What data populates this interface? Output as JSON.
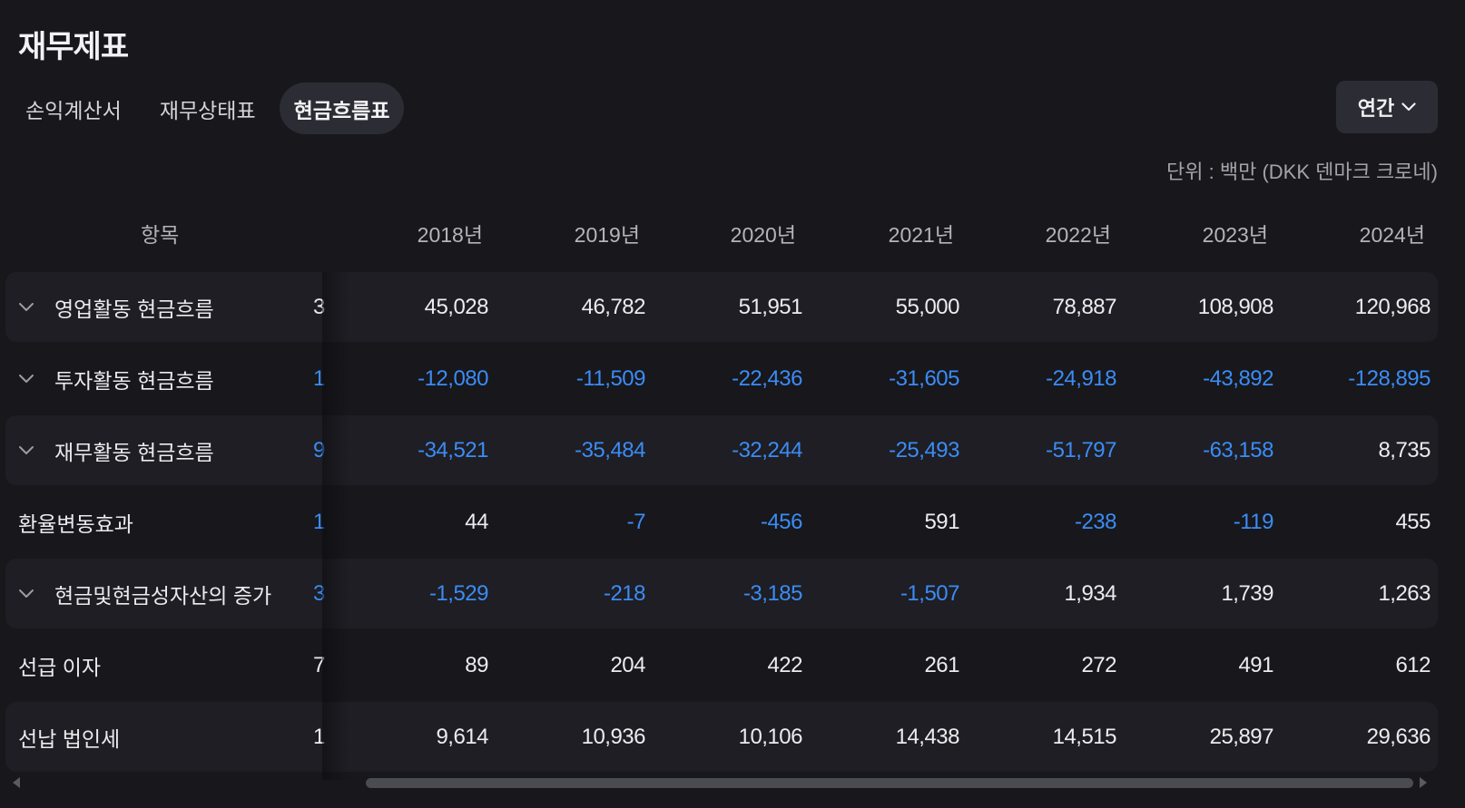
{
  "title": "재무제표",
  "tabs": [
    {
      "label": "손익계산서",
      "active": false
    },
    {
      "label": "재무상태표",
      "active": false
    },
    {
      "label": "현금흐름표",
      "active": true
    }
  ],
  "period": {
    "label": "연간",
    "icon": "chevron-down-icon"
  },
  "unit": "단위 : 백만 (DKK 덴마크 크로네)",
  "table": {
    "item_header": "항목",
    "years": [
      "2018년",
      "2019년",
      "2020년",
      "2021년",
      "2022년",
      "2023년",
      "2024년"
    ],
    "rows": [
      {
        "label": "영업활동 현금흐름",
        "expandable": true,
        "cut": "3",
        "cut_neg": false,
        "values": [
          "45,028",
          "46,782",
          "51,951",
          "55,000",
          "78,887",
          "108,908",
          "120,968"
        ],
        "neg": [
          false,
          false,
          false,
          false,
          false,
          false,
          false
        ]
      },
      {
        "label": "투자활동 현금흐름",
        "expandable": true,
        "cut": "1",
        "cut_neg": true,
        "values": [
          "-12,080",
          "-11,509",
          "-22,436",
          "-31,605",
          "-24,918",
          "-43,892",
          "-128,895"
        ],
        "neg": [
          true,
          true,
          true,
          true,
          true,
          true,
          true
        ]
      },
      {
        "label": "재무활동 현금흐름",
        "expandable": true,
        "cut": "9",
        "cut_neg": true,
        "values": [
          "-34,521",
          "-35,484",
          "-32,244",
          "-25,493",
          "-51,797",
          "-63,158",
          "8,735"
        ],
        "neg": [
          true,
          true,
          true,
          true,
          true,
          true,
          false
        ]
      },
      {
        "label": "환율변동효과",
        "expandable": false,
        "cut": "1",
        "cut_neg": true,
        "values": [
          "44",
          "-7",
          "-456",
          "591",
          "-238",
          "-119",
          "455"
        ],
        "neg": [
          false,
          true,
          true,
          false,
          true,
          true,
          false
        ]
      },
      {
        "label": "현금및현금성자산의 증가",
        "expandable": true,
        "cut": "3",
        "cut_neg": true,
        "values": [
          "-1,529",
          "-218",
          "-3,185",
          "-1,507",
          "1,934",
          "1,739",
          "1,263"
        ],
        "neg": [
          true,
          true,
          true,
          true,
          false,
          false,
          false
        ]
      },
      {
        "label": "선급 이자",
        "expandable": false,
        "cut": "7",
        "cut_neg": false,
        "values": [
          "89",
          "204",
          "422",
          "261",
          "272",
          "491",
          "612"
        ],
        "neg": [
          false,
          false,
          false,
          false,
          false,
          false,
          false
        ]
      },
      {
        "label": "선납 법인세",
        "expandable": false,
        "cut": "1",
        "cut_neg": false,
        "values": [
          "9,614",
          "10,936",
          "10,106",
          "14,438",
          "14,515",
          "25,897",
          "29,636"
        ],
        "neg": [
          false,
          false,
          false,
          false,
          false,
          false,
          false
        ]
      }
    ]
  },
  "colors": {
    "background": "#17171c",
    "negative": "#3b8cf5",
    "active_tab": "#2c2c34",
    "row_shade": "#1e1e24"
  }
}
